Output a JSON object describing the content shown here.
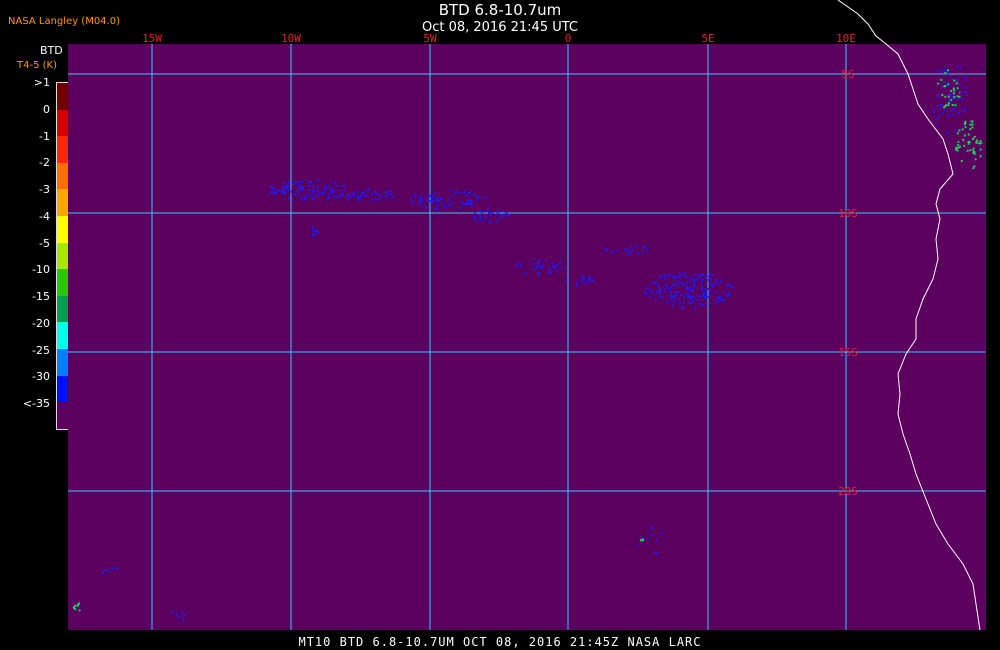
{
  "header": {
    "title": "BTD 6.8-10.7um",
    "subtitle": "Oct 08, 2016 21:45 UTC",
    "credit": "NASA Langley (M04.0)"
  },
  "legend": {
    "title": "BTD",
    "units": "T4-5 (K)",
    "labels": [
      ">1",
      "0",
      "-1",
      "-2",
      "-3",
      "-4",
      "-5",
      "-10",
      "-15",
      "-20",
      "-25",
      "-30",
      "<-35"
    ],
    "colors": [
      "#700000",
      "#d00000",
      "#ff2800",
      "#ff7000",
      "#ffa800",
      "#ffff00",
      "#a8e800",
      "#28c800",
      "#00a050",
      "#00ffe8",
      "#0080ff",
      "#0010ff",
      "#5c0060"
    ]
  },
  "map": {
    "background": "#5c0060",
    "grid_color": "#33ccff",
    "lon_labels": [
      "15W",
      "10W",
      "5W",
      "0",
      "5E",
      "10E"
    ],
    "lat_labels": [
      "5S",
      "10S",
      "15S",
      "20S"
    ],
    "lon_label_color": "#e8202a",
    "lat_label_color": "#e8202a",
    "coast_color": "#ffffff",
    "cloud_color": "#1a1aff",
    "green_color": "#1fd060"
  },
  "footer": "MT10  BTD 6.8-10.7UM  OCT 08, 2016 21:45Z  NASA LARC"
}
